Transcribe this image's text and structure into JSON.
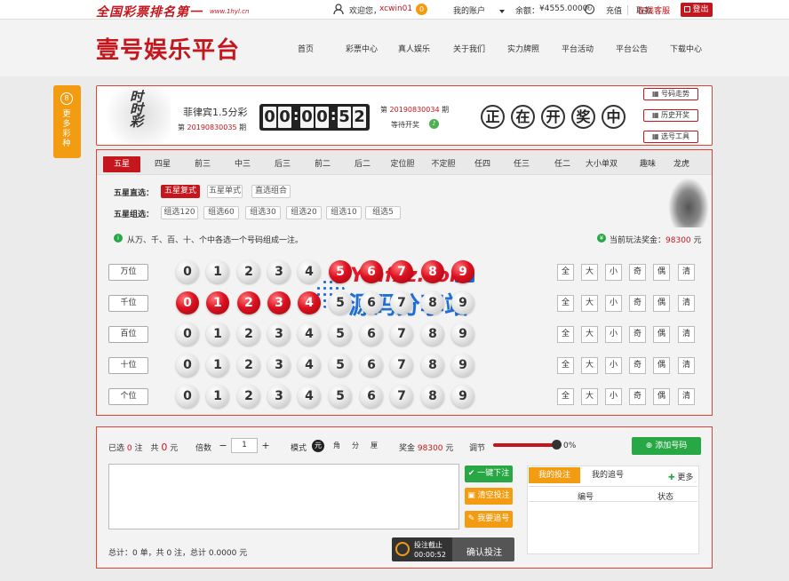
{
  "top": {
    "slogan": "全国彩票排名第一",
    "slogan_url": "www.1hyl.cn",
    "welcome": "欢迎您，",
    "username": "xcwin01",
    "badge": "0",
    "account": "我的账户",
    "balance_label": "余额：",
    "balance": "¥4555.0000",
    "recharge": "充值",
    "withdraw": "取款",
    "service": "在线客服",
    "logout": "登出"
  },
  "header": {
    "logo": "壹号娱乐平台",
    "nav": [
      "首页",
      "彩票中心",
      "真人娱乐",
      "关于我们",
      "实力牌照",
      "平台活动",
      "平台公告",
      "下载中心"
    ]
  },
  "side": {
    "count": "8",
    "label": "更多彩种"
  },
  "game": {
    "logo_text": "时时彩",
    "name": "菲律宾1.5分彩",
    "current_label": "第",
    "current_issue": "20190830035",
    "issue_suffix": "期",
    "countdown": [
      "0",
      "0",
      "0",
      "0",
      "5",
      "2"
    ],
    "prev_label": "第",
    "prev_issue": "20190830034",
    "prev_suffix": "期",
    "waiting": "等待开奖",
    "drawing": [
      "正",
      "在",
      "开",
      "奖",
      "中"
    ],
    "tools": [
      "号码走势",
      "历史开奖",
      "选号工具"
    ]
  },
  "tabs": [
    "五星",
    "四星",
    "前三",
    "中三",
    "后三",
    "前二",
    "后二",
    "定位胆",
    "不定胆",
    "任四",
    "任三",
    "任二",
    "大小单双",
    "趣味",
    "龙虎"
  ],
  "selector": {
    "direct_label": "五星直选：",
    "direct": [
      "五星复式",
      "五星单式",
      "直选组合"
    ],
    "group_label": "五星组选：",
    "group": [
      "组选120",
      "组选60",
      "组选30",
      "组选20",
      "组选10",
      "组选5"
    ],
    "hint": "从万、千、百、十、个中各选一个号码组成一注。",
    "prize_label": "当前玩法奖金：",
    "prize": "98300",
    "prize_unit": "元"
  },
  "positions": [
    {
      "label": "万位",
      "selected": [
        5,
        6,
        7,
        8,
        9
      ]
    },
    {
      "label": "千位",
      "selected": [
        0,
        1,
        2,
        3,
        4
      ]
    },
    {
      "label": "百位",
      "selected": []
    },
    {
      "label": "十位",
      "selected": []
    },
    {
      "label": "个位",
      "selected": []
    }
  ],
  "digits": [
    "0",
    "1",
    "2",
    "3",
    "4",
    "5",
    "6",
    "7",
    "8",
    "9"
  ],
  "filters": [
    "全",
    "大",
    "小",
    "奇",
    "偶",
    "清"
  ],
  "watermark": {
    "line1": "Ymfxz.com",
    "badge": "官网",
    "line2": "源码分享站"
  },
  "bet": {
    "selected_label": "已选",
    "selected": "0",
    "zhu": "注",
    "total_label": "共",
    "total": "0",
    "yuan": "元",
    "mult_label": "倍数",
    "mult": "1",
    "mode_label": "模式",
    "modes": [
      "元",
      "角",
      "分",
      "厘"
    ],
    "prize_label": "奖金",
    "prize": "98300",
    "prize_unit": "元",
    "adjust_label": "调节",
    "adjust_pct": "0%",
    "adjust_value": 1.0,
    "add": "添加号码",
    "quick": "一键下注",
    "clear": "清空投注",
    "random": "我要追号",
    "tab1": "我的投注",
    "tab2": "我的追号",
    "more": "更多",
    "col1": "编号",
    "col2": "状态",
    "summary": "总计：0 单，共 0 注，总计 0.0000 元",
    "deadline_label": "投注截止",
    "deadline": "00:00:52",
    "confirm": "确认投注"
  }
}
